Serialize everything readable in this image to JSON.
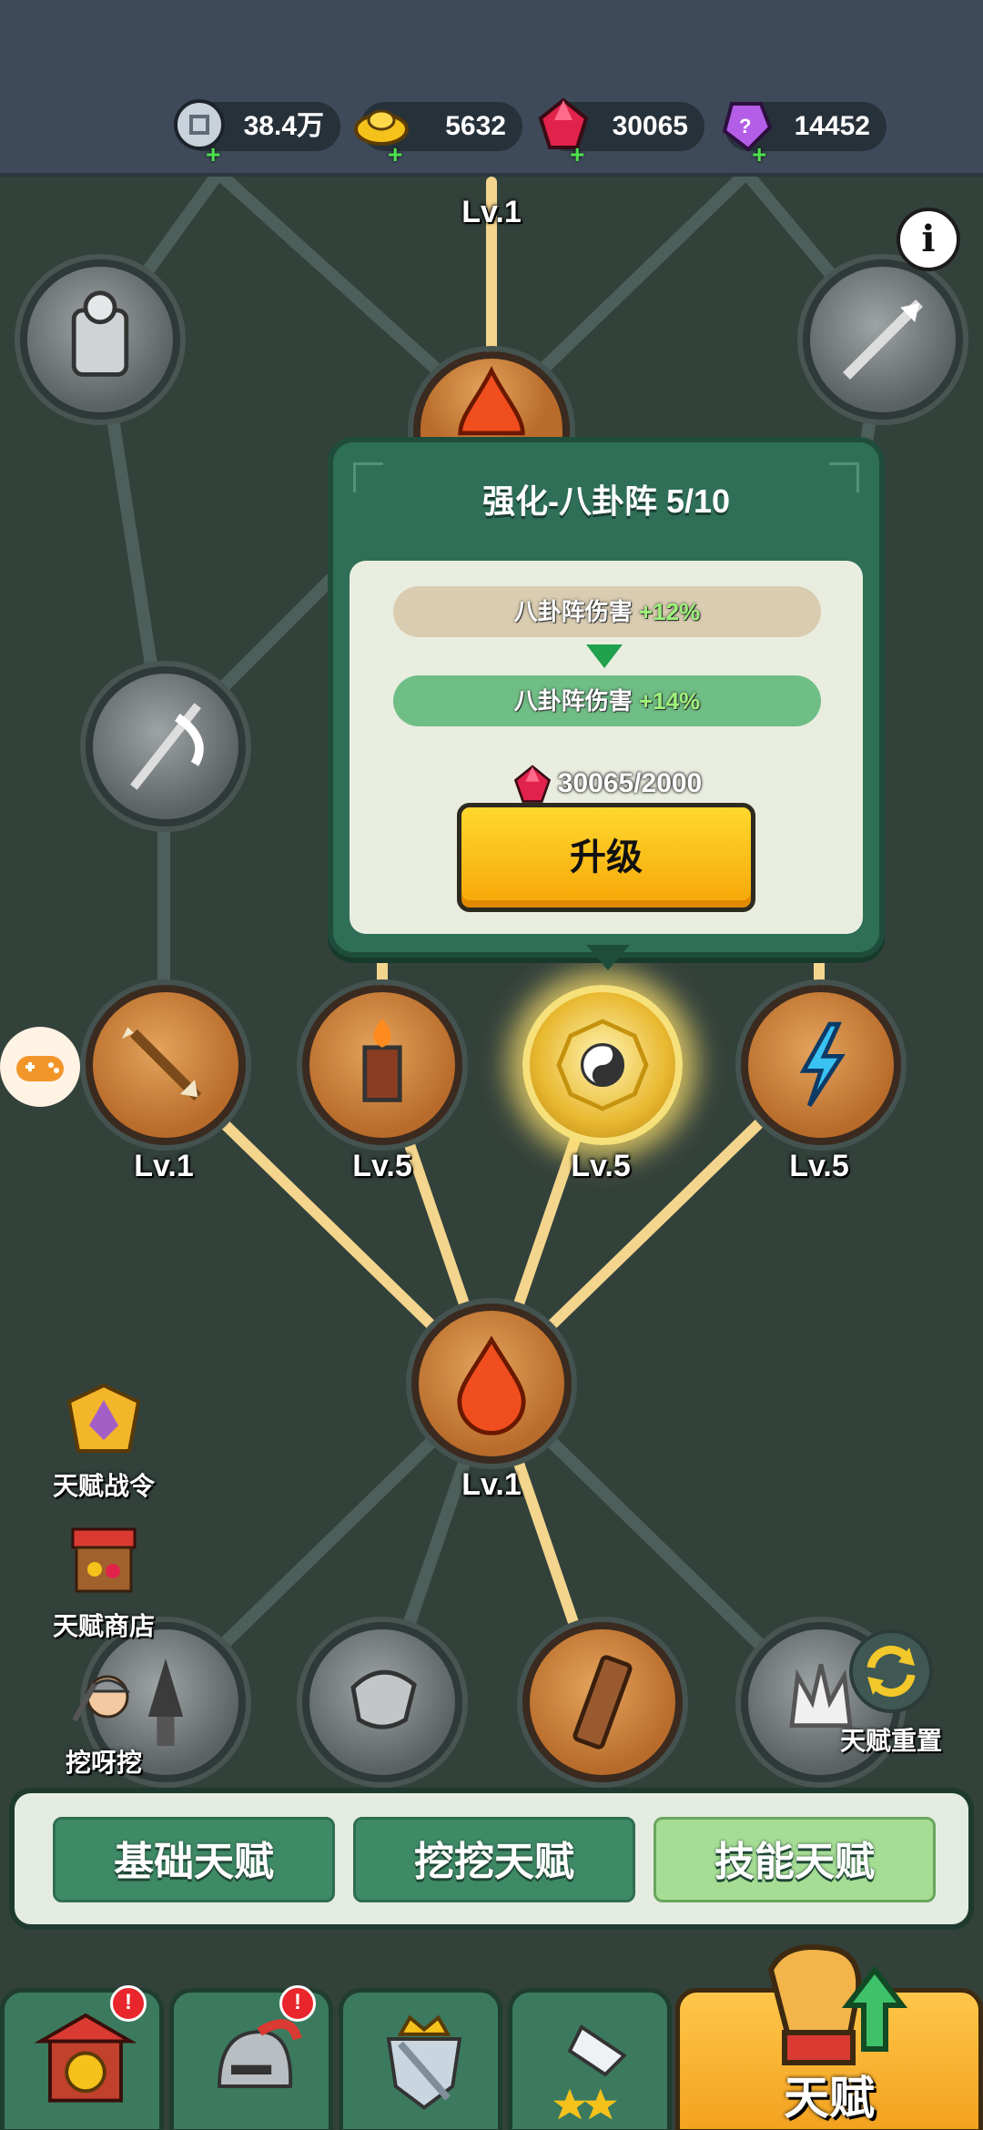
{
  "currencies": [
    {
      "name": "silver-coin",
      "value": "38.4万",
      "color": "#c9d2db"
    },
    {
      "name": "gold-ingot",
      "value": "5632",
      "color": "#f5c21b"
    },
    {
      "name": "red-gem",
      "value": "30065",
      "color": "#e1234c"
    },
    {
      "name": "purple-crystal",
      "value": "14452",
      "color": "#b45ee8"
    }
  ],
  "tree": {
    "top_level": "Lv.1",
    "row_levels": [
      "Lv.1",
      "Lv.5",
      "Lv.5",
      "Lv.5"
    ],
    "center_level": "Lv.1"
  },
  "popup": {
    "title": "强化-八卦阵 5/10",
    "current_stat_label": "八卦阵伤害",
    "current_stat_bonus": "+12%",
    "next_stat_label": "八卦阵伤害",
    "next_stat_bonus": "+14%",
    "cost": "30065/2000",
    "upgrade_label": "升级"
  },
  "side": {
    "pass_label": "天赋战令",
    "shop_label": "天赋商店",
    "dig_label": "挖呀挖",
    "reset_label": "天赋重置"
  },
  "tabs": [
    {
      "label": "基础天赋",
      "active": false
    },
    {
      "label": "挖挖天赋",
      "active": false
    },
    {
      "label": "技能天赋",
      "active": true
    }
  ],
  "bottom_nav": {
    "talent_label": "天赋",
    "badge": "!"
  },
  "colors": {
    "background": "#33413b",
    "accent_green": "#2f6e57",
    "upgrade_yellow": "#ffc61a",
    "line_gold": "#f3d58d",
    "line_gray": "#4c5f5a"
  }
}
